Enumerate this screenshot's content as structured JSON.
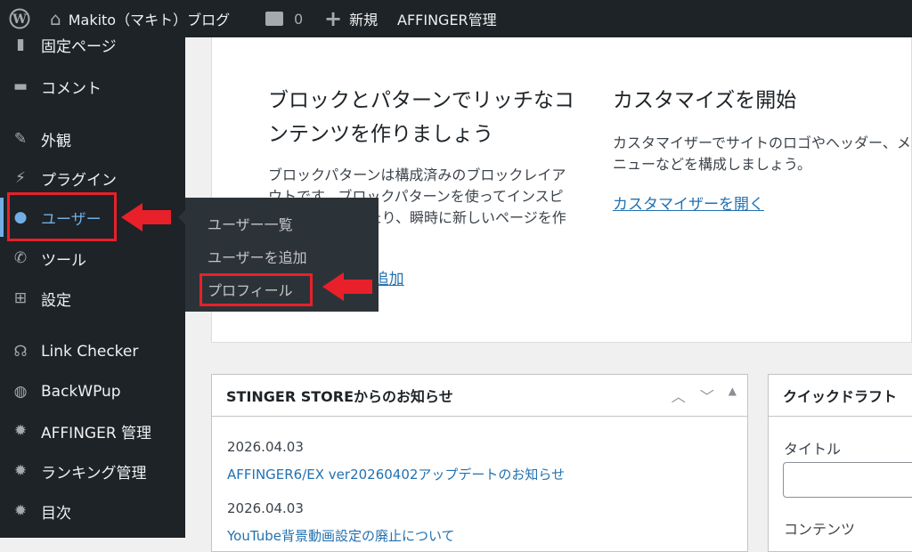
{
  "topbar": {
    "site_name": "Makito（マキト）ブログ",
    "comments_count": "0",
    "new_label": "新規",
    "affinger_label": "AFFINGER管理"
  },
  "sidebar": {
    "items": [
      {
        "label": "固定ページ",
        "icon": "page-icon"
      },
      {
        "label": "コメント",
        "icon": "comment-icon"
      },
      {
        "label": "外観",
        "icon": "brush-icon"
      },
      {
        "label": "プラグイン",
        "icon": "plugin-icon"
      },
      {
        "label": "ユーザー",
        "icon": "user-icon",
        "active": true
      },
      {
        "label": "ツール",
        "icon": "wrench-icon"
      },
      {
        "label": "設定",
        "icon": "settings-icon"
      },
      {
        "label": "Link Checker",
        "icon": "link-icon"
      },
      {
        "label": "BackWPup",
        "icon": "backup-icon"
      },
      {
        "label": "AFFINGER 管理",
        "icon": "gear-icon"
      },
      {
        "label": "ランキング管理",
        "icon": "gear-icon"
      },
      {
        "label": "目次",
        "icon": "gear-icon"
      }
    ]
  },
  "flyout": {
    "items": [
      "ユーザー一覧",
      "ユーザーを追加",
      "プロフィール"
    ]
  },
  "welcome": {
    "col1": {
      "title": "ブロックとパターンでリッチなコンテンツを作りましょう",
      "text": "ブロックパターンは構成済みのブロックレイアウトです。ブロックパターンを使ってインスピレーションを得たり、瞬時に新しいページを作成できます。",
      "link": "新しいページを追加"
    },
    "col2": {
      "title": "カスタマイズを開始",
      "text": "カスタマイザーでサイトのロゴやヘッダー、メニューなどを構成しましょう。",
      "link": "カスタマイザーを開く"
    }
  },
  "news": {
    "title": "STINGER STOREからのお知らせ",
    "items": [
      {
        "date": "2026.04.03",
        "title": "AFFINGER6/EX ver20260402アップデートのお知らせ"
      },
      {
        "date": "2026.04.03",
        "title": "YouTube背景動画設定の廃止について"
      }
    ]
  },
  "quickdraft": {
    "title": "クイックドラフト",
    "title_label": "タイトル",
    "content_label": "コンテンツ",
    "title_value": ""
  },
  "colors": {
    "accent": "#72aee6",
    "link": "#2271b1",
    "annotation": "#e8202a"
  }
}
